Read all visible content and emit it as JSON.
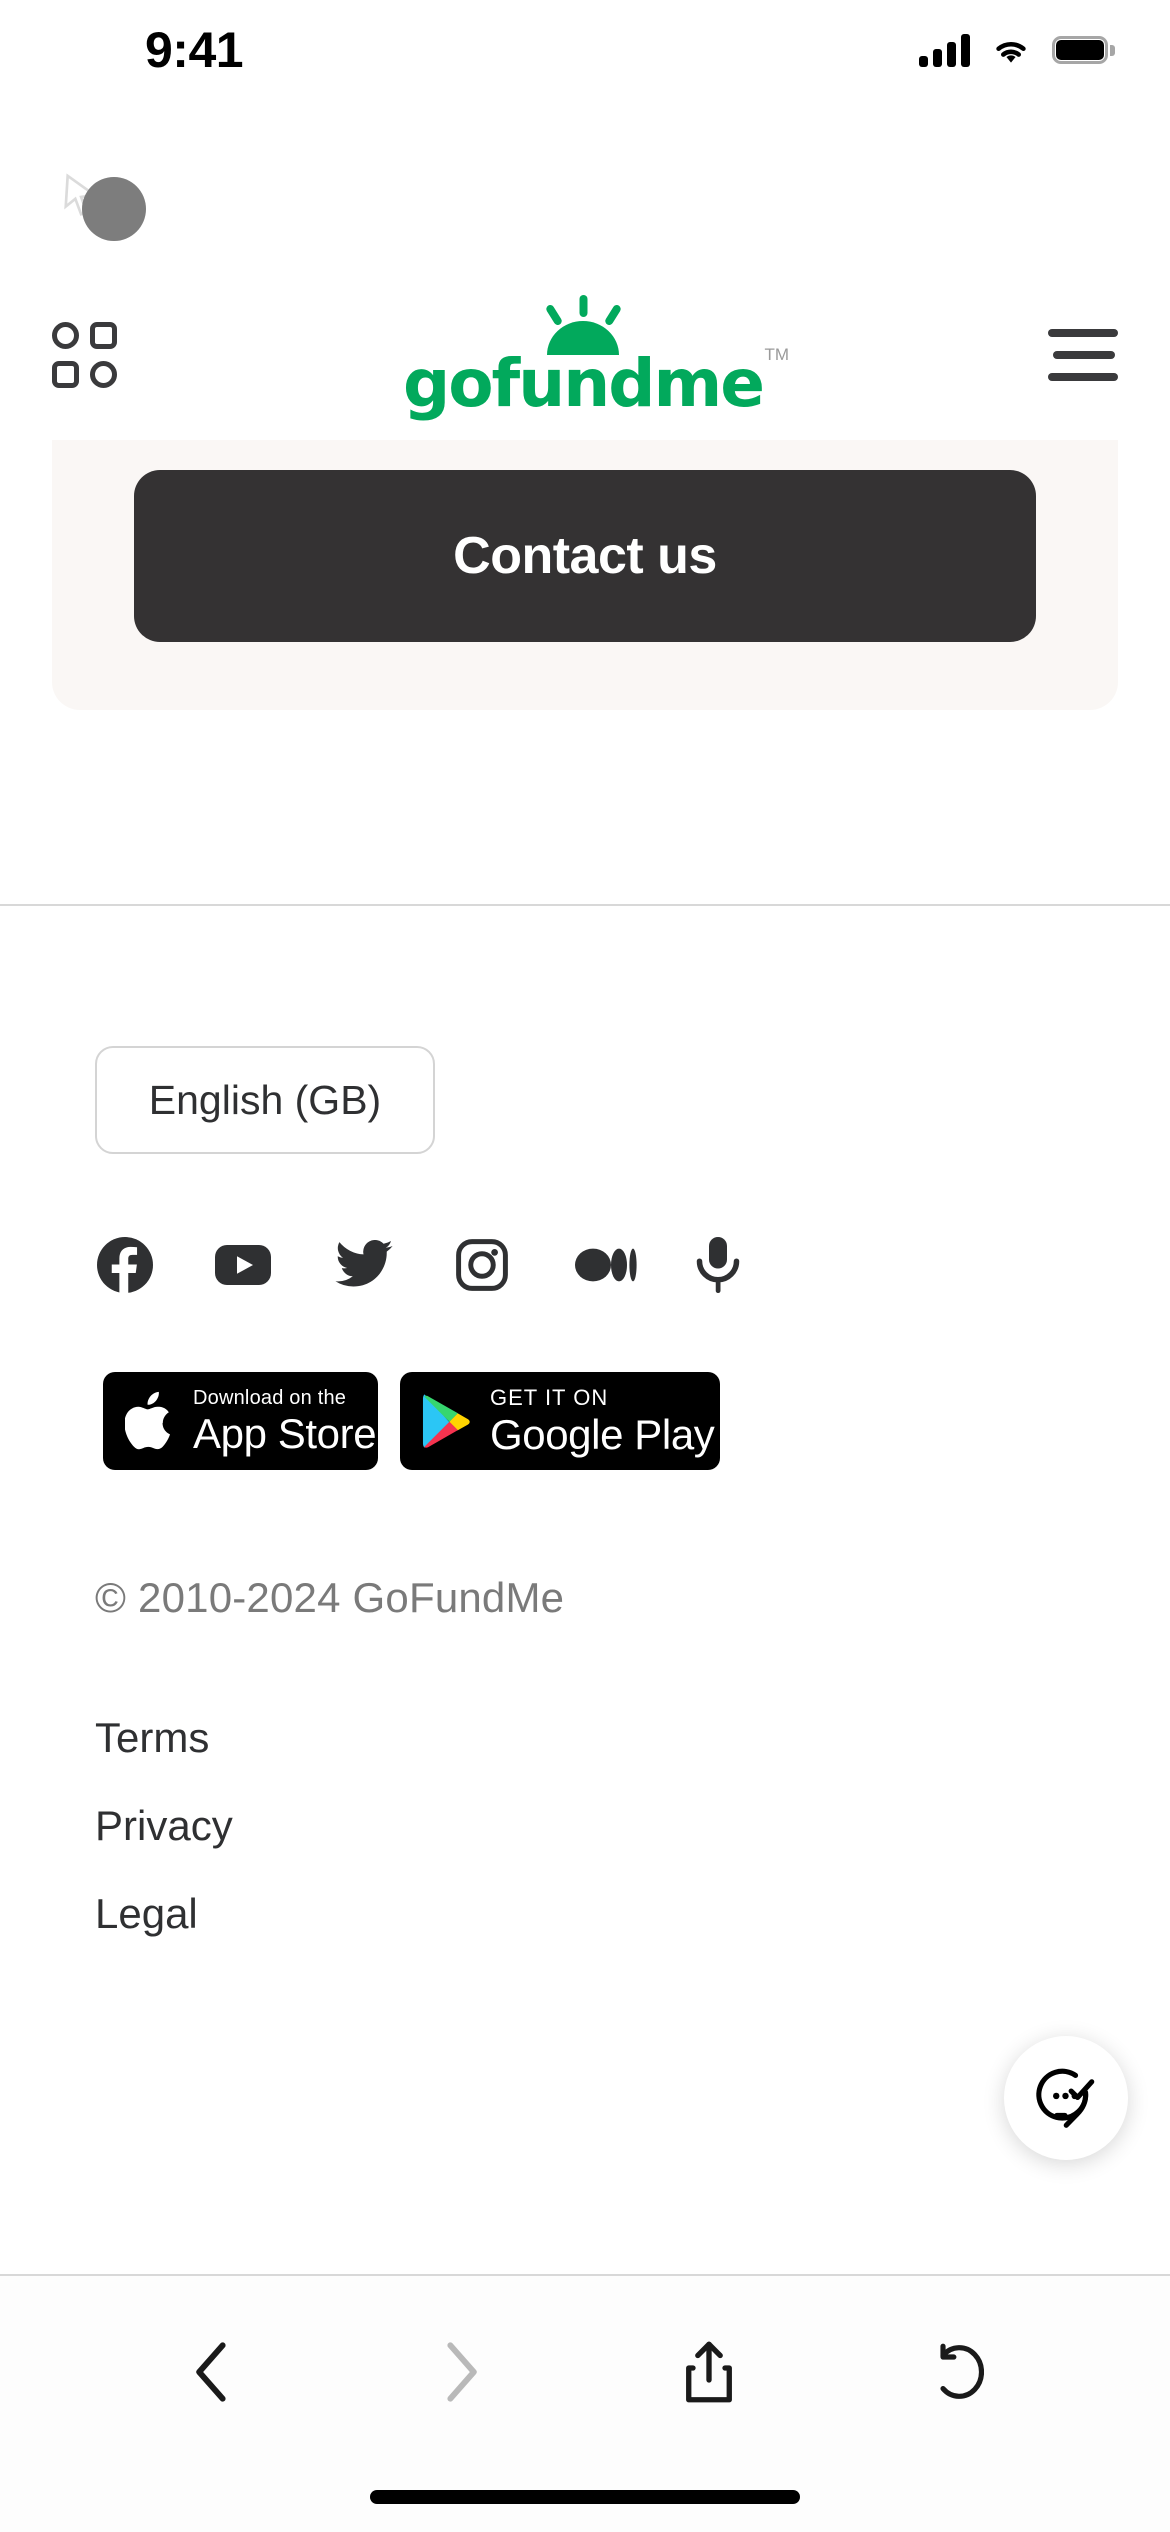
{
  "status_bar": {
    "time": "9:41",
    "signal_icon": "cellular-bars-icon",
    "wifi_icon": "wifi-icon",
    "battery_icon": "battery-full-icon"
  },
  "header": {
    "grid_button_icon": "grid-apps-icon",
    "logo_mark_icon": "gofundme-sunburst-icon",
    "logo_wordmark": "gofundme",
    "trademark": "TM",
    "menu_icon": "hamburger-menu-icon",
    "brand_green": "#02a95c"
  },
  "contact_section": {
    "button_label": "Contact us",
    "card_background": "#faf7f5",
    "button_background": "#343233"
  },
  "footer": {
    "language": {
      "selected": "English (GB)",
      "icon": "globe-language-icon"
    },
    "social_links": [
      {
        "name": "facebook-icon",
        "label": "Facebook"
      },
      {
        "name": "youtube-icon",
        "label": "YouTube"
      },
      {
        "name": "twitter-icon",
        "label": "Twitter"
      },
      {
        "name": "instagram-icon",
        "label": "Instagram"
      },
      {
        "name": "medium-icon",
        "label": "Medium"
      },
      {
        "name": "microphone-icon",
        "label": "Podcast"
      }
    ],
    "app_badges": {
      "apple": {
        "small": "Download on the",
        "big": "App Store",
        "icon": "apple-logo-icon"
      },
      "google": {
        "small": "GET IT ON",
        "big": "Google Play",
        "icon": "google-play-icon"
      }
    },
    "copyright": "© 2010-2024 GoFundMe",
    "links": [
      {
        "label": "Terms"
      },
      {
        "label": "Privacy"
      },
      {
        "label": "Legal"
      }
    ]
  },
  "chat_widget": {
    "icon": "chat-bubble-check-icon"
  },
  "browser_toolbar": {
    "back_icon": "chevron-left-icon",
    "forward_icon": "chevron-right-icon",
    "share_icon": "share-up-icon",
    "reload_icon": "reload-circular-arrow-icon",
    "forward_disabled": true
  }
}
